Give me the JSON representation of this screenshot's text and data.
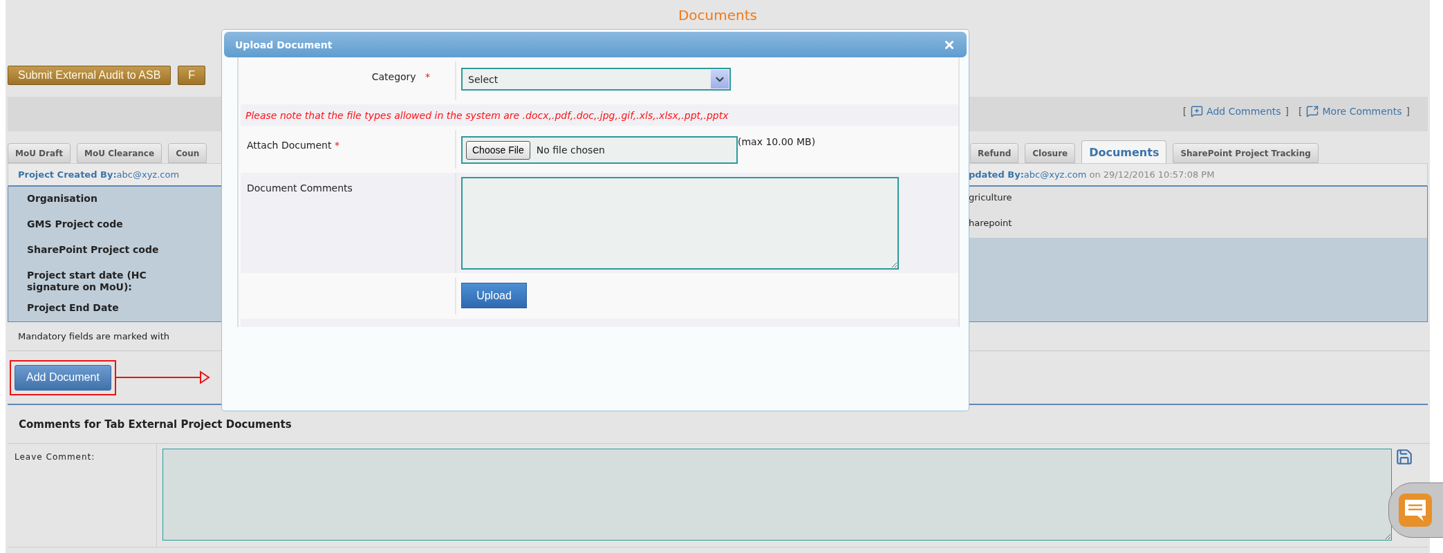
{
  "page_title": "Documents",
  "action_buttons": [
    {
      "label": "Submit External Audit to ASB"
    },
    {
      "label": "F"
    }
  ],
  "comment_links": [
    {
      "kind": "add",
      "before": "[",
      "label": "Add Comments",
      "after": "]"
    },
    {
      "kind": "more",
      "before": "[",
      "label": "More Comments",
      "after": "]"
    }
  ],
  "tabs_left": [
    {
      "label": "MoU Draft",
      "selected": false
    },
    {
      "label": "MoU Clearance",
      "selected": false
    },
    {
      "label": "Coun",
      "selected": false
    }
  ],
  "tabs_right": [
    {
      "label": "Refund",
      "selected": false
    },
    {
      "label": "Closure",
      "selected": false
    },
    {
      "label": "Documents",
      "selected": true
    },
    {
      "label": "SharePoint Project Tracking",
      "selected": false
    }
  ],
  "created_by": {
    "label": "Project Created By:",
    "value": "abc@xyz.com"
  },
  "updated_by": {
    "label": "pdated By:",
    "value": "abc@xyz.com",
    "suffix": "on 29/12/2016 10:57:08 PM"
  },
  "details": [
    {
      "label": "Organisation",
      "value": "griculture"
    },
    {
      "label": "GMS Project code",
      "value": "harepoint"
    },
    {
      "label": "SharePoint Project code"
    },
    {
      "label": "Project start date (HC signature on MoU):"
    },
    {
      "label": "Project End Date"
    }
  ],
  "mandatory_note": "Mandatory fields are marked with",
  "add_document_button": "Add Document",
  "comments_section": {
    "title": "Comments for Tab External Project Documents",
    "label": "Leave Comment:"
  },
  "dialog": {
    "title": "Upload Document",
    "category": {
      "label": "Category",
      "required_mark": "*",
      "value": "Select"
    },
    "note": "Please note that the file types allowed in the system are .docx,.pdf,.doc,.jpg,.gif,.xls,.xlsx,.ppt,.pptx",
    "attach": {
      "label": "Attach Document",
      "required_mark": "*",
      "button": "Choose File",
      "status": "No file chosen",
      "hint": "(max 10.00 MB)"
    },
    "comments": {
      "label": "Document Comments"
    },
    "upload_button": "Upload"
  }
}
